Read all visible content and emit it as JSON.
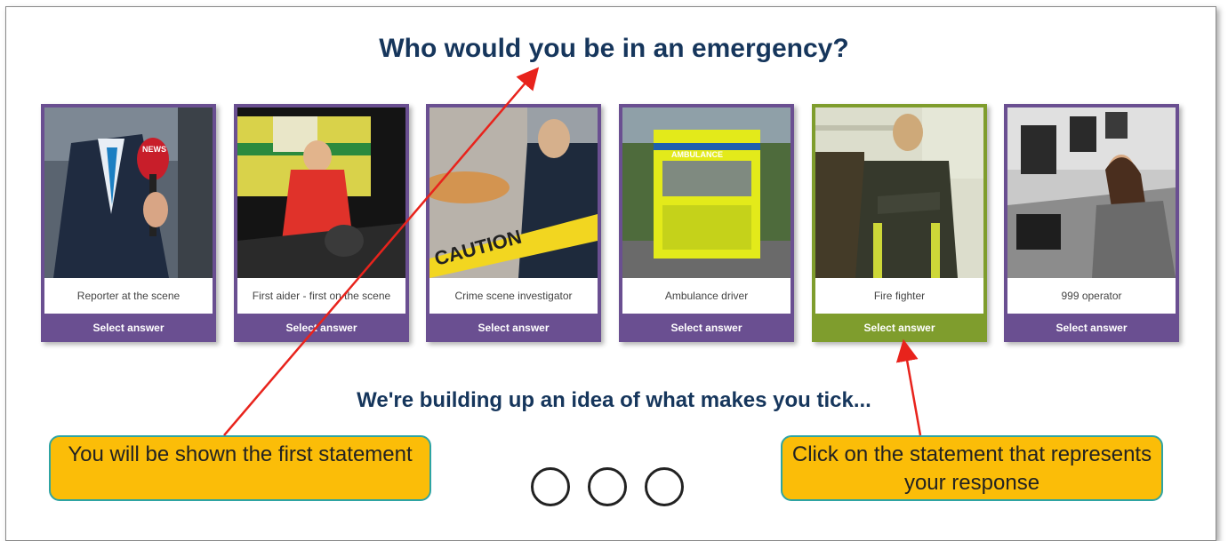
{
  "question": "Who would you be in an emergency?",
  "cards": [
    {
      "label": "Reporter at the scene",
      "button": "Select answer",
      "image": "reporter-photo"
    },
    {
      "label": "First aider - first on the scene",
      "button": "Select answer",
      "image": "first-aider-photo"
    },
    {
      "label": "Crime scene investigator",
      "button": "Select answer",
      "image": "crime-scene-photo",
      "caution_text": "CAUTION"
    },
    {
      "label": "Ambulance driver",
      "button": "Select answer",
      "image": "ambulance-photo",
      "ambulance_text": "AMBULANCE"
    },
    {
      "label": "Fire fighter",
      "button": "Select answer",
      "image": "firefighter-photo",
      "selected": true
    },
    {
      "label": "999 operator",
      "button": "Select answer",
      "image": "call-centre-photo"
    }
  ],
  "subtitle": "We're building up an idea of what makes you tick...",
  "callouts": {
    "left": "You will be shown the first statement",
    "right": "Click on the statement that represents your response"
  },
  "progress_dots": 3,
  "colors": {
    "card_border": "#6a4f91",
    "selected": "#7f9d2d",
    "heading": "#16365c",
    "callout_bg": "#fbbd08",
    "callout_border": "#2ea4a3",
    "arrow": "#e8231c"
  }
}
